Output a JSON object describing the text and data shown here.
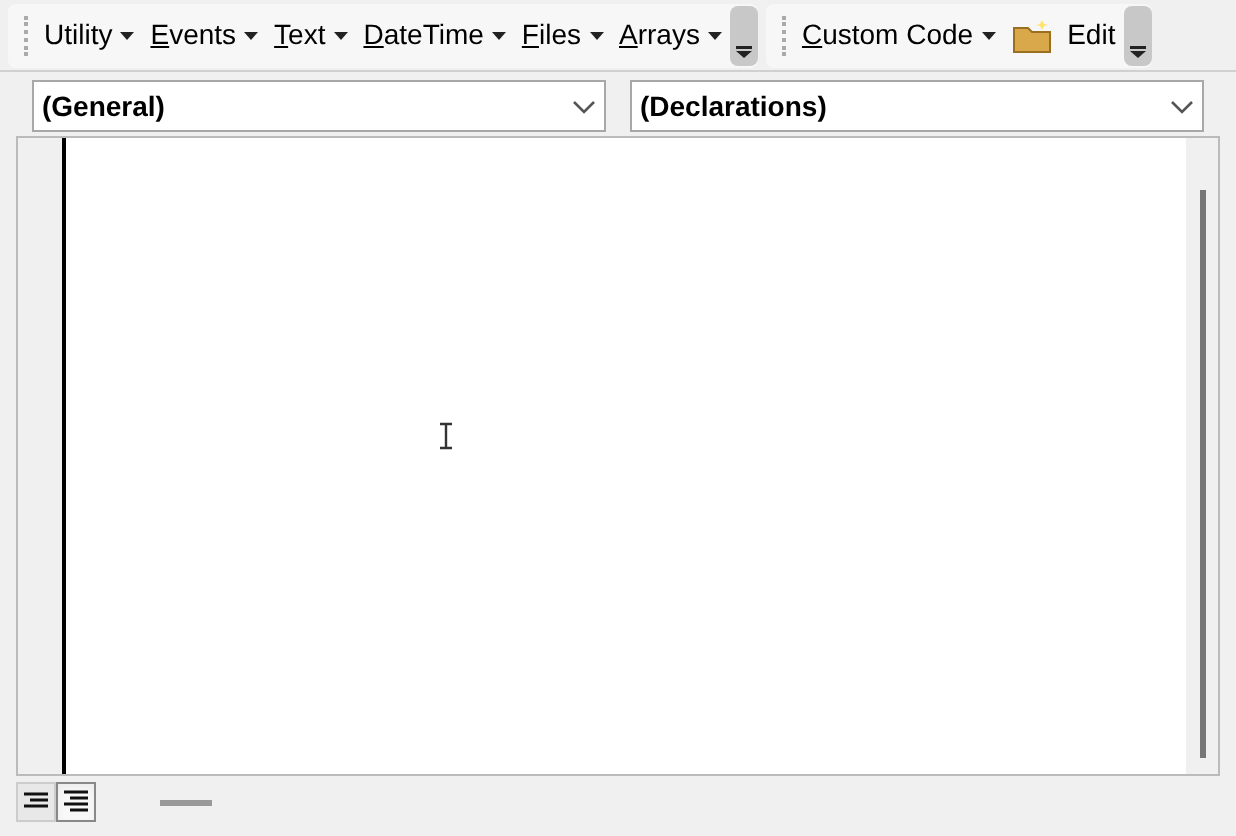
{
  "toolbar_1": {
    "menus": [
      {
        "rest": "Utility"
      },
      {
        "key": "E",
        "rest": "vents"
      },
      {
        "key": "T",
        "rest": "ext"
      },
      {
        "key": "D",
        "rest": "ateTime"
      },
      {
        "key": "F",
        "rest": "iles"
      },
      {
        "key": "A",
        "rest": "rrays"
      }
    ]
  },
  "toolbar_2": {
    "menus": [
      {
        "key": "C",
        "rest": "ustom Code"
      }
    ],
    "edit_button": "Edit"
  },
  "object_combo": {
    "value": "(General)"
  },
  "procedure_combo": {
    "value": "(Declarations)"
  },
  "view_buttons": [
    {
      "kind": "procedure",
      "selected": false
    },
    {
      "kind": "full",
      "selected": true
    }
  ]
}
